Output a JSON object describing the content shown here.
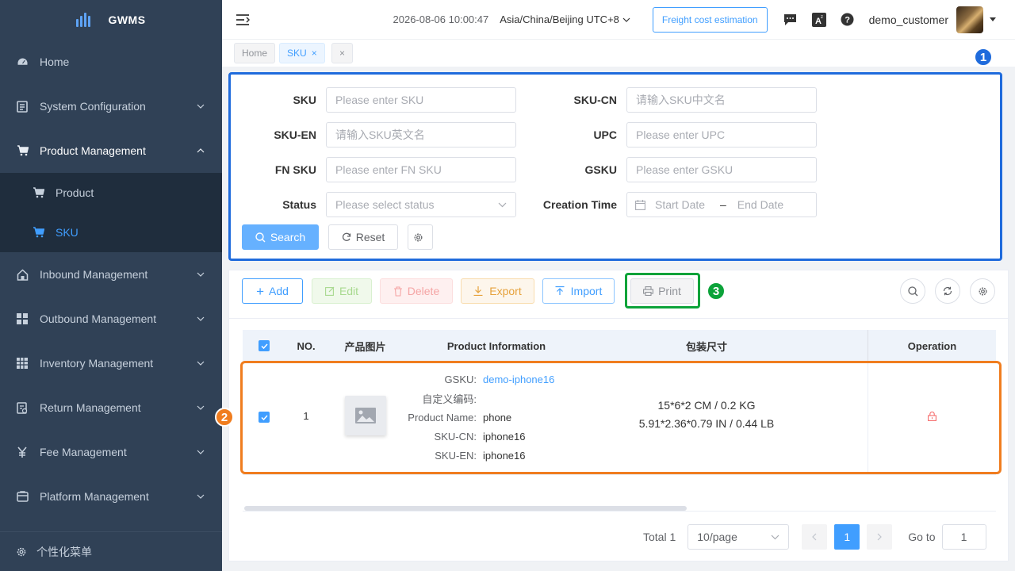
{
  "app": {
    "title": "GWMS"
  },
  "sidebar": {
    "items": [
      {
        "label": "Home",
        "icon": "dashboard-icon"
      },
      {
        "label": "System Configuration",
        "icon": "document-icon"
      },
      {
        "label": "Product Management",
        "icon": "cart-icon",
        "expanded": true,
        "children": [
          {
            "label": "Product",
            "icon": "cart-icon"
          },
          {
            "label": "SKU",
            "icon": "cart-icon",
            "active": true
          }
        ]
      },
      {
        "label": "Inbound Management",
        "icon": "house-icon"
      },
      {
        "label": "Outbound Management",
        "icon": "grid-icon"
      },
      {
        "label": "Inventory Management",
        "icon": "table-icon"
      },
      {
        "label": "Return Management",
        "icon": "return-icon"
      },
      {
        "label": "Fee Management",
        "icon": "yen-icon"
      },
      {
        "label": "Platform Management",
        "icon": "platform-icon"
      }
    ],
    "footer_label": "个性化菜单"
  },
  "header": {
    "datetime": "2026-08-06 10:00:47",
    "timezone": "Asia/China/Beijing UTC+8",
    "freight_button": "Freight cost estimation",
    "username": "demo_customer"
  },
  "tags": [
    {
      "label": "Home"
    },
    {
      "label": "SKU",
      "active": true
    }
  ],
  "search": {
    "fields": [
      {
        "label": "SKU",
        "placeholder": "Please enter SKU"
      },
      {
        "label": "SKU-CN",
        "placeholder": "请输入SKU中文名"
      },
      {
        "label": "SKU-EN",
        "placeholder": "请输入SKU英文名"
      },
      {
        "label": "UPC",
        "placeholder": "Please enter UPC"
      },
      {
        "label": "FN SKU",
        "placeholder": "Please enter FN SKU"
      },
      {
        "label": "GSKU",
        "placeholder": "Please enter GSKU"
      },
      {
        "label": "Status",
        "placeholder": "Please select status"
      },
      {
        "label": "Creation Time",
        "start_placeholder": "Start Date",
        "separator": "–",
        "end_placeholder": "End Date"
      }
    ],
    "search_button": "Search",
    "reset_button": "Reset"
  },
  "toolbar": {
    "add": "Add",
    "edit": "Edit",
    "delete": "Delete",
    "export": "Export",
    "import": "Import",
    "print": "Print"
  },
  "table": {
    "columns": [
      "NO.",
      "产品图片",
      "Product Information",
      "包装尺寸",
      "Operation"
    ],
    "rows": [
      {
        "no": "1",
        "info": [
          {
            "key": "GSKU:",
            "value": "demo-iphone16"
          },
          {
            "key": "自定义编码:",
            "value": ""
          },
          {
            "key": "Product Name:",
            "value": "phone"
          },
          {
            "key": "SKU-CN:",
            "value": "iphone16"
          },
          {
            "key": "SKU-EN:",
            "value": "iphone16"
          }
        ],
        "size_cm": "15*6*2 CM / 0.2 KG",
        "size_in": "5.91*2.36*0.79 IN / 0.44 LB"
      }
    ]
  },
  "pagination": {
    "total": "Total 1",
    "page_size": "10/page",
    "current_page": "1",
    "goto_label": "Go to",
    "goto_value": "1"
  },
  "annotations": [
    {
      "number": "1",
      "color": "#1f6bdc"
    },
    {
      "number": "2",
      "color": "#f07d1f"
    },
    {
      "number": "3",
      "color": "#0ca33a"
    }
  ]
}
